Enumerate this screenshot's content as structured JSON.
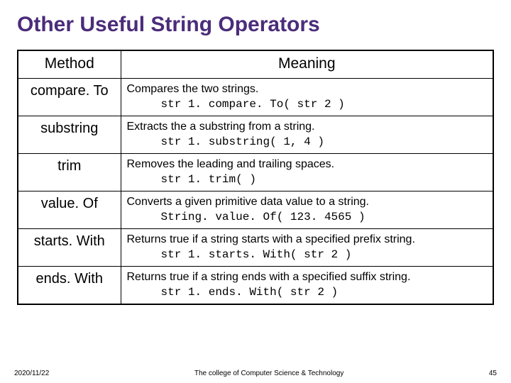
{
  "title": "Other Useful String Operators",
  "headers": {
    "method": "Method",
    "meaning": "Meaning"
  },
  "rows": [
    {
      "method": "compare. To",
      "desc": "Compares the two strings.",
      "code": "str 1. compare. To( str 2 )"
    },
    {
      "method": "substring",
      "desc": "Extracts the a substring from a string.",
      "code": "str 1. substring( 1, 4 )"
    },
    {
      "method": "trim",
      "desc": "Removes the leading and trailing spaces.",
      "code": "str 1. trim( )"
    },
    {
      "method": "value. Of",
      "desc": "Converts a given primitive data value to a string.",
      "code": "String. value. Of( 123. 4565 )"
    },
    {
      "method": "starts. With",
      "desc": "Returns true if a string starts with a specified prefix string.",
      "code": "str 1. starts. With( str 2 )"
    },
    {
      "method": "ends. With",
      "desc": "Returns true if a string ends with a specified suffix string.",
      "code": "str 1. ends. With( str 2 )"
    }
  ],
  "footer": {
    "date": "2020/11/22",
    "center": "The college of Computer Science & Technology",
    "page": "45"
  }
}
